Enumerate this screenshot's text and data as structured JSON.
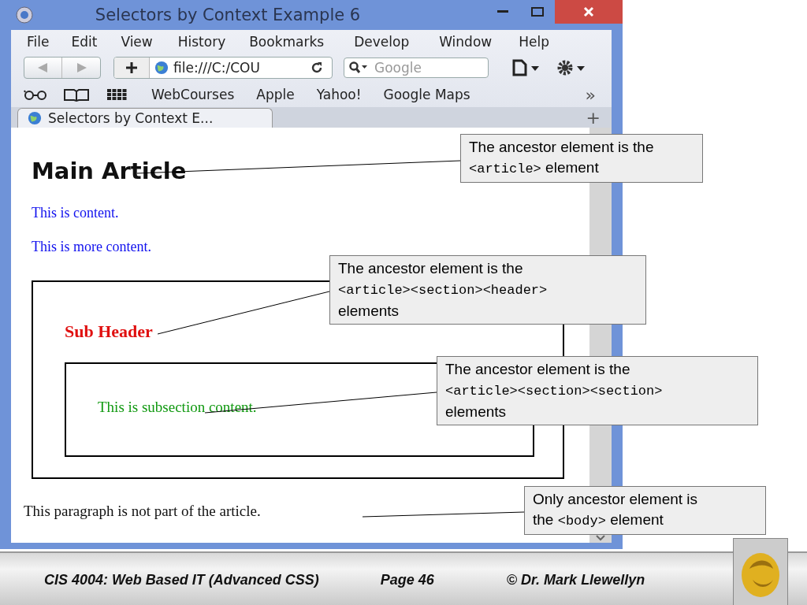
{
  "window": {
    "title": "Selectors by Context Example 6"
  },
  "menu": [
    {
      "label": "File"
    },
    {
      "label": "Edit"
    },
    {
      "label": "View"
    },
    {
      "label": "History"
    },
    {
      "label": "Bookmarks"
    },
    {
      "label": "Develop"
    },
    {
      "label": "Window"
    },
    {
      "label": "Help"
    }
  ],
  "toolbar": {
    "address": "file:///C:/COU",
    "search": {
      "placeholder": "Google"
    }
  },
  "bookmarks": [
    {
      "label": "WebCourses"
    },
    {
      "label": "Apple"
    },
    {
      "label": "Yahoo!"
    },
    {
      "label": "Google Maps"
    }
  ],
  "bookmarks_overflow": "»",
  "tabs": [
    {
      "label": "Selectors by Context E...",
      "selected": true
    }
  ],
  "new_tab": "+",
  "page": {
    "heading": "Main Article",
    "paragraphs": [
      "This is content.",
      "This is more content."
    ],
    "section": {
      "heading": "Sub Header",
      "subsection": "This is subsection content."
    },
    "footer_text": "This paragraph is not part of the article."
  },
  "callouts": [
    {
      "lines": [
        [
          {
            "kind": "text",
            "text": "The ancestor element is the"
          }
        ],
        [
          {
            "kind": "code",
            "text": "<article>"
          },
          {
            "kind": "text",
            "text": " element"
          }
        ]
      ]
    },
    {
      "lines": [
        [
          {
            "kind": "text",
            "text": "The ancestor element is the"
          }
        ],
        [
          {
            "kind": "code",
            "text": "<article><section><header>"
          }
        ],
        [
          {
            "kind": "text",
            "text": "elements"
          }
        ]
      ]
    },
    {
      "lines": [
        [
          {
            "kind": "text",
            "text": "The ancestor element is the"
          }
        ],
        [
          {
            "kind": "code",
            "text": "<article><section><section>"
          }
        ],
        [
          {
            "kind": "text",
            "text": "elements"
          }
        ]
      ]
    },
    {
      "lines": [
        [
          {
            "kind": "text",
            "text": "Only ancestor element is"
          }
        ],
        [
          {
            "kind": "text",
            "text": "the "
          },
          {
            "kind": "code",
            "text": "<body>"
          },
          {
            "kind": "text",
            "text": " element"
          }
        ]
      ]
    }
  ],
  "slide_footer": {
    "course": "CIS 4004: Web Based IT (Advanced CSS)",
    "page": "Page 46",
    "author": "© Dr. Mark Llewellyn"
  }
}
